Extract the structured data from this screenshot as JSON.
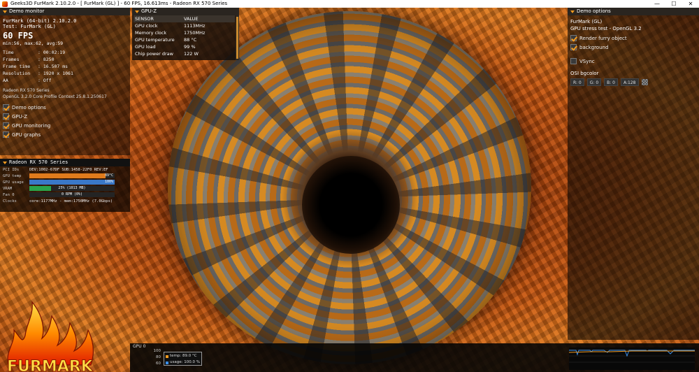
{
  "window": {
    "title": "Geeks3D FurMark 2.10.2.0 - [ FurMark (GL) ] - 60 FPS, 16.613ms - Radeon RX 570 Series",
    "controls": {
      "minimize": "—",
      "maximize": "☐",
      "close": "✕"
    }
  },
  "demo_monitor": {
    "header": "Demo monitor",
    "line1": "FurMark (64-bit) 2.10.2.0",
    "line2": "Test: FurMark (GL)",
    "fps": "60 FPS",
    "minmax": "min:56, max:62, avg:59",
    "stats": [
      {
        "label": "Time",
        "value": ": 00:02:19"
      },
      {
        "label": "Frames",
        "value": ": 8250"
      },
      {
        "label": "Frame time",
        "value": ": 16.507 ms"
      },
      {
        "label": "Resolution",
        "value": ": 1920 x 1061"
      },
      {
        "label": "AA",
        "value": ": Off"
      }
    ],
    "gpu_name": "Radeon RX 570 Series",
    "gl_info": "OpenGL 3.2.0 Core Profile Context 25.8.1.250617",
    "options": [
      {
        "label": "Demo options",
        "checked": true
      },
      {
        "label": "GPU-Z",
        "checked": true
      },
      {
        "label": "GPU monitoring",
        "checked": true
      },
      {
        "label": "GPU graphs",
        "checked": true
      }
    ]
  },
  "radeon_panel": {
    "header": "Radeon RX 570 Series",
    "pci_label": "PCI IDs",
    "pci_value": "DEV:1002-67DF SUB:1458-22F0 REV:EF",
    "rows": [
      {
        "label": "GPU temp",
        "value": "89°C",
        "fraction": 0.89,
        "color": "#e07b1c"
      },
      {
        "label": "GPU usage",
        "value": "100%",
        "fraction": 1.0,
        "color": "#3a78c8"
      },
      {
        "label": "VRAM",
        "value": "25% (1013 MB)",
        "fraction": 0.25,
        "color": "#2aa44a"
      },
      {
        "label": "Fan 0",
        "value": "0 RPM (0%)",
        "fraction": 0.0,
        "color": "#888888"
      }
    ],
    "clocks_label": "Clocks",
    "clocks_value": "core:1177MHz - mem:1750MHz (7.0Gbps)"
  },
  "gpuz": {
    "header": "GPU-Z",
    "col_sensor": "SENSOR",
    "col_value": "VALUE",
    "rows": [
      {
        "sensor": "GPU clock",
        "value": "1113MHz"
      },
      {
        "sensor": "Memory clock",
        "value": "1750MHz"
      },
      {
        "sensor": "GPU temperature",
        "value": "88 °C"
      },
      {
        "sensor": "GPU load",
        "value": "99 %"
      },
      {
        "sensor": "Chip power draw",
        "value": "122 W"
      }
    ]
  },
  "demo_options": {
    "header": "Demo options",
    "title": "FurMark (GL)",
    "subtitle": "GPU stress test - OpenGL 3.2",
    "checks": [
      {
        "label": "Render furry object",
        "checked": true
      },
      {
        "label": "background",
        "checked": true
      }
    ],
    "vsync": {
      "label": "VSync",
      "checked": false
    },
    "osi_label": "OSI bgcolor",
    "colors": {
      "r": "R: 0",
      "g": "G: 0",
      "b": "B: 0",
      "a": "A:128"
    }
  },
  "graph": {
    "title": "GPU 0",
    "yticks": [
      "100",
      "80",
      "60"
    ],
    "legend": [
      {
        "label": "temp: 89.0 °C",
        "color": "#f49b1f"
      },
      {
        "label": "usage: 100.0 %",
        "color": "#3a8ee8"
      }
    ]
  },
  "logo": {
    "text": "FURMARK"
  },
  "colors": {
    "accent": "#f49b1f",
    "usage_blue": "#3a8ee8"
  }
}
